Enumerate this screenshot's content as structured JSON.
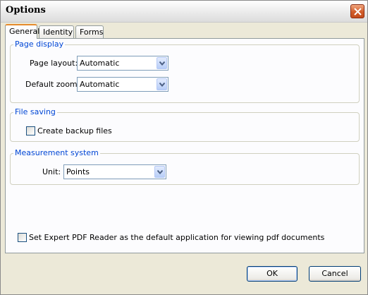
{
  "window": {
    "title": "Options"
  },
  "tabs": [
    {
      "label": "General",
      "active": true
    },
    {
      "label": "Identity",
      "active": false
    },
    {
      "label": "Forms",
      "active": false
    }
  ],
  "page_display": {
    "title": "Page display",
    "page_layout": {
      "label": "Page layout:",
      "value": "Automatic"
    },
    "default_zoom": {
      "label": "Default zoom:",
      "value": "Automatic"
    }
  },
  "file_saving": {
    "title": "File saving",
    "create_backup": {
      "label": "Create backup files",
      "checked": false
    }
  },
  "measurement": {
    "title": "Measurement system",
    "unit": {
      "label": "Unit:",
      "value": "Points"
    }
  },
  "default_app": {
    "label": "Set Expert PDF Reader as the default application for viewing pdf documents",
    "checked": false
  },
  "buttons": {
    "ok": "OK",
    "cancel": "Cancel"
  },
  "colors": {
    "group_title": "#0046d5",
    "tab_highlight": "#e68b2c",
    "close_button": "#d15c2a"
  }
}
